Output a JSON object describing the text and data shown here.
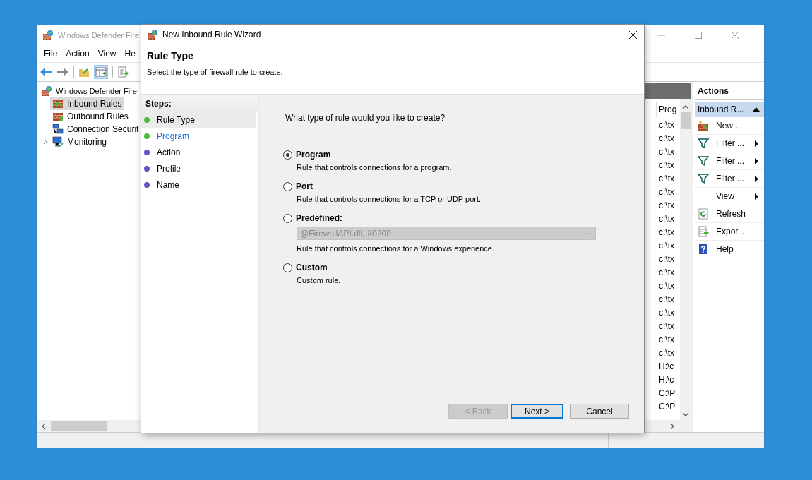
{
  "main_window": {
    "title": "Windows Defender Fire",
    "menu": [
      "File",
      "Action",
      "View",
      "He"
    ],
    "tree": [
      {
        "label": "Windows Defender Fire",
        "selected": false,
        "children": [
          {
            "label": "Inbound Rules",
            "selected": true,
            "kind": "inbound"
          },
          {
            "label": "Outbound Rules",
            "selected": false,
            "kind": "outbound"
          },
          {
            "label": "Connection Securit",
            "selected": false,
            "kind": "connection"
          },
          {
            "label": "Monitoring",
            "selected": false,
            "kind": "monitoring",
            "expanded": false
          }
        ]
      }
    ],
    "list": {
      "column_header": "Prog",
      "rows": [
        "c:\\tx",
        "c:\\tx",
        "c:\\tx",
        "c:\\tx",
        "c:\\tx",
        "c:\\tx",
        "c:\\tx",
        "c:\\tx",
        "c:\\tx",
        "c:\\tx",
        "c:\\tx",
        "c:\\tx",
        "c:\\tx",
        "c:\\tx",
        "c:\\tx",
        "c:\\tx",
        "c:\\tx",
        "c:\\tx",
        "H:\\c",
        "H:\\c",
        "C:\\P",
        "C:\\P"
      ]
    },
    "actions": {
      "title": "Actions",
      "section": {
        "label": "Inbound R...",
        "expanded": true
      },
      "items": [
        {
          "label": "New ...",
          "kind": "new",
          "submenu": false
        },
        {
          "label": "Filter ...",
          "kind": "filter",
          "submenu": true
        },
        {
          "label": "Filter ...",
          "kind": "filter",
          "submenu": true
        },
        {
          "label": "Filter ...",
          "kind": "filter",
          "submenu": true
        },
        {
          "label": "View",
          "kind": "view",
          "submenu": true
        },
        {
          "label": "Refresh",
          "kind": "refresh",
          "submenu": false
        },
        {
          "label": "Expor...",
          "kind": "export",
          "submenu": false
        },
        {
          "label": "Help",
          "kind": "help",
          "submenu": false
        }
      ]
    }
  },
  "wizard": {
    "title": "New Inbound Rule Wizard",
    "heading": "Rule Type",
    "subtitle": "Select the type of firewall rule to create.",
    "steps_title": "Steps:",
    "steps": [
      {
        "label": "Rule Type",
        "selected": true,
        "link": false,
        "color": "#4cbb3c"
      },
      {
        "label": "Program",
        "selected": false,
        "link": true,
        "color": "#4cbb3c"
      },
      {
        "label": "Action",
        "selected": false,
        "link": false,
        "color": "#5b55c8"
      },
      {
        "label": "Profile",
        "selected": false,
        "link": false,
        "color": "#5b55c8"
      },
      {
        "label": "Name",
        "selected": false,
        "link": false,
        "color": "#5b55c8"
      }
    ],
    "question": "What type of rule would you like to create?",
    "options": [
      {
        "label": "Program",
        "selected": true,
        "description": "Rule that controls connections for a program."
      },
      {
        "label": "Port",
        "selected": false,
        "description": "Rule that controls connections for a TCP or UDP port."
      },
      {
        "label": "Predefined:",
        "selected": false,
        "dropdown": {
          "value": "@FirewallAPI.dll,-80200",
          "disabled": true
        },
        "description": "Rule that controls connections for a Windows experience."
      },
      {
        "label": "Custom",
        "selected": false,
        "description": "Custom rule."
      }
    ],
    "buttons": [
      {
        "label": "< Back",
        "disabled": true,
        "default": false
      },
      {
        "label": "Next >",
        "disabled": false,
        "default": true
      },
      {
        "label": "Cancel",
        "disabled": false,
        "default": false
      }
    ]
  }
}
